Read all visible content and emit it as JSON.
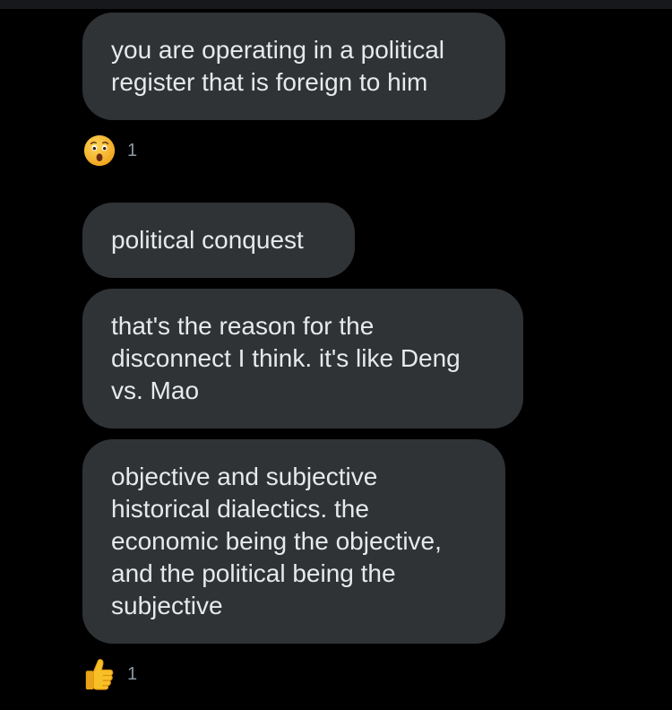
{
  "messages": [
    {
      "text": "you are operating in a political\nregister that is foreign to him"
    },
    {
      "text": "political conquest"
    },
    {
      "text": "that's the reason for the\ndisconnect I think. it's like Deng\nvs. Mao"
    },
    {
      "text": "objective and subjective\nhistorical dialectics. the\neconomic being the objective,\nand the political being the\nsubjective"
    }
  ],
  "reactions": [
    {
      "emoji": "astonished-face-icon",
      "count": "1"
    },
    {
      "emoji": "thumbs-up-icon",
      "count": "1"
    }
  ],
  "colors": {
    "background": "#000000",
    "bubble": "#2f3336",
    "text": "#e7e9ea",
    "count": "#8b98a5"
  }
}
